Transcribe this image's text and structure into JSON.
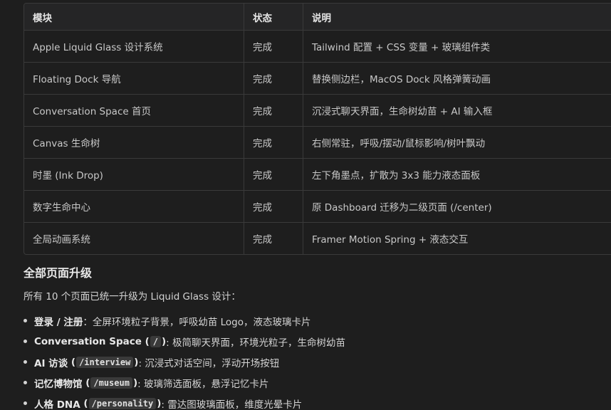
{
  "table": {
    "headers": [
      "模块",
      "状态",
      "说明"
    ],
    "rows": [
      [
        "Apple Liquid Glass 设计系统",
        "完成",
        "Tailwind 配置 + CSS 变量 + 玻璃组件类"
      ],
      [
        "Floating Dock 导航",
        "完成",
        "替换侧边栏，MacOS Dock 风格弹簧动画"
      ],
      [
        "Conversation Space 首页",
        "完成",
        "沉浸式聊天界面，生命树幼苗 + AI 输入框"
      ],
      [
        "Canvas 生命树",
        "完成",
        "右侧常驻，呼吸/摆动/鼠标影响/树叶飘动"
      ],
      [
        "时墨 (Ink Drop)",
        "完成",
        "左下角墨点，扩散为 3x3 能力液态面板"
      ],
      [
        "数字生命中心",
        "完成",
        "原 Dashboard 迁移为二级页面 (/center)"
      ],
      [
        "全局动画系统",
        "完成",
        "Framer Motion Spring + 液态交互"
      ]
    ]
  },
  "section": {
    "title": "全部页面升级",
    "intro": "所有 10 个页面已统一升级为 Liquid Glass 设计："
  },
  "list": [
    {
      "bold": "登录 / 注册",
      "code": "",
      "after": "：全屏环境粒子背景，呼吸幼苗 Logo，液态玻璃卡片"
    },
    {
      "bold": "Conversation Space",
      "code": "/",
      "after": ": 极简聊天界面，环境光粒子，生命树幼苗"
    },
    {
      "bold": "AI 访谈",
      "code": "/interview",
      "after": ": 沉浸式对话空间，浮动开场按钮"
    },
    {
      "bold": "记忆博物馆",
      "code": "/museum",
      "after": ": 玻璃筛选面板，悬浮记忆卡片"
    },
    {
      "bold": "人格 DNA",
      "code": "/personality",
      "after": ": 雷达图玻璃面板，维度光晕卡片"
    }
  ]
}
